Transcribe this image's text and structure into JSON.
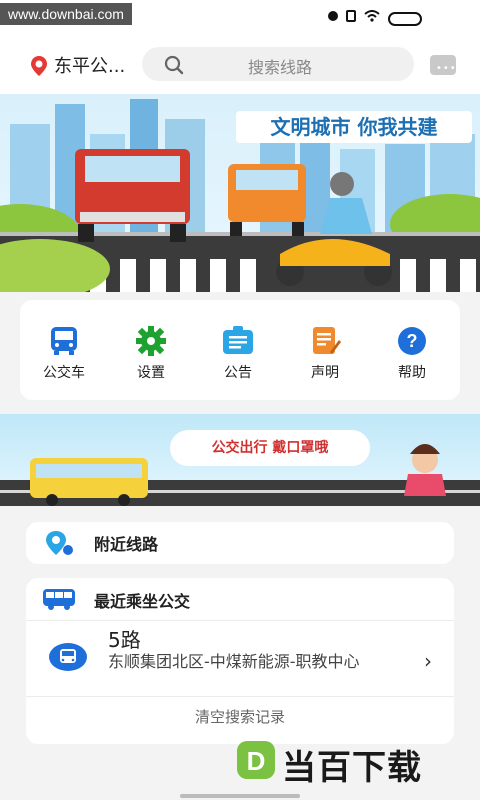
{
  "watermark_top": "www.downbai.com",
  "header": {
    "city": "东平公...",
    "search_placeholder": "搜索线路"
  },
  "banner": {
    "slogan": "文明城市 你我共建"
  },
  "menu": [
    {
      "label": "公交车",
      "icon": "bus-icon",
      "color": "#1e6fd9"
    },
    {
      "label": "设置",
      "icon": "gear-icon",
      "color": "#1ea22f"
    },
    {
      "label": "公告",
      "icon": "notice-icon",
      "color": "#2aa6e6"
    },
    {
      "label": "声明",
      "icon": "document-icon",
      "color": "#f08a2c"
    },
    {
      "label": "帮助",
      "icon": "help-icon",
      "color": "#1e6fd9"
    }
  ],
  "banner2": {
    "text": "公交出行 戴口罩哦"
  },
  "nearby": {
    "label": "附近线路"
  },
  "recent": {
    "label": "最近乘坐公交",
    "route": {
      "name": "5路",
      "description": "东顺集团北区-中煤新能源-职教中心"
    },
    "clear_label": "清空搜索记录"
  },
  "watermark_bottom": "当百下载",
  "colors": {
    "accent_blue": "#1e6fd9",
    "pin_red": "#e53935"
  }
}
